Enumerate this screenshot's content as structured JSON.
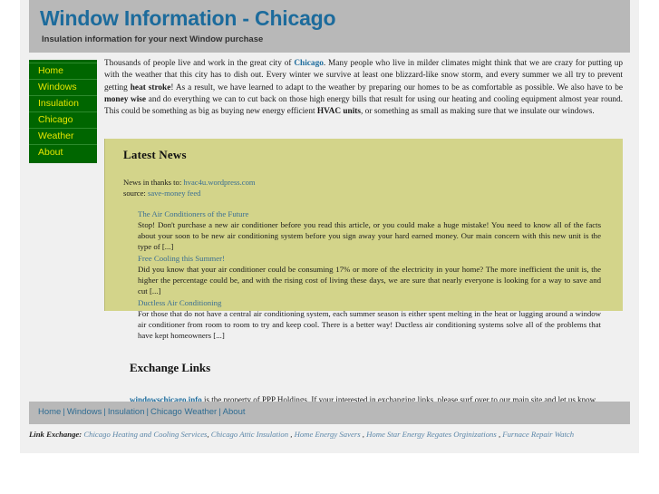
{
  "header": {
    "title": "Window Information - Chicago",
    "tagline": "Insulation information for your next Window purchase"
  },
  "sidebar": {
    "items": [
      {
        "label": "Home"
      },
      {
        "label": "Windows"
      },
      {
        "label": "Insulation"
      },
      {
        "label": "Chicago"
      },
      {
        "label": "Weather"
      },
      {
        "label": "About"
      }
    ]
  },
  "intro": {
    "part1": "Thousands of people live and work in the great city of ",
    "link_chicago": "Chicago",
    "part2": ". Many people who live in milder climates might think that we are crazy for putting up with the weather that this city has to dish out. Every winter we survive at least one blizzard-like snow storm, and every summer we all try to prevent getting ",
    "bold1": "heat stroke",
    "part3": "! As a result, we have learned to adapt to the weather by preparing our homes to be as comfortable as possible. We also have to be ",
    "bold2": "money wise",
    "part4": " and do everything we can to cut back on those high energy bills that result for using our heating and cooling equipment almost year round. This could be something as big as buying new energy efficient ",
    "bold3": "HVAC units",
    "part5": ", or something as small as making sure that we insulate our windows."
  },
  "news": {
    "heading": "Latest News",
    "credit_label": "News in thanks to: ",
    "credit_link": "hvac4u.wordpress.com",
    "source_label": "source: ",
    "source_link": "save-money feed",
    "items": [
      {
        "title": "The Air Conditioners of the Future",
        "body": "Stop! Don't purchase a new air conditioner before you read this article, or you could make a huge mistake! You need to know all of the facts about your soon to be new air conditioning system before you sign away your hard earned money. Our main concern with this new unit is the type of [...]"
      },
      {
        "title": "Free Cooling this Summer!",
        "body": "Did you know that your air conditioner could be consuming 17% or more of the electricity in your home? The more inefficient the unit is, the higher the percentage could be, and with the rising cost of living these days, we are sure that nearly everyone is looking for a way to save and cut [...]"
      },
      {
        "title": "Ductless Air Conditioning",
        "body": "For those that do not have a central air conditioning system, each summer season is either spent melting in the heat or lugging around a window air conditioner from room to room to try and keep cool. There is a better way! Ductless air conditioning systems solve all of the problems that have kept homeowners [...]"
      }
    ]
  },
  "exchange": {
    "heading": "Exchange Links",
    "domain": "windowschicago.info",
    "body": " is the property of PPP Holdings. If your interested in exchanging links, please surf over to our main site and let us know."
  },
  "footer_nav": {
    "items": [
      {
        "label": "Home"
      },
      {
        "label": "Windows"
      },
      {
        "label": "Insulation"
      },
      {
        "label": "Chicago Weather"
      },
      {
        "label": "About"
      }
    ],
    "separator": "|"
  },
  "link_exchange": {
    "label": "Link Exchange:",
    "links": [
      {
        "label": "Chicago Heating and Cooling Services"
      },
      {
        "label": "Chicago Attic Insulation"
      },
      {
        "label": "Home Energy Savers"
      },
      {
        "label": "Home Star Energy Regates Orginizations"
      },
      {
        "label": "Furnace Repair Watch"
      }
    ],
    "separator": ","
  },
  "colors": {
    "header_bg": "#b8b8b8",
    "title_blue": "#1c6b9c",
    "sidebar_green": "#006600",
    "sidebar_text": "#e6e600",
    "news_bg": "#d3d48a",
    "link_blue": "#3b6f93"
  }
}
